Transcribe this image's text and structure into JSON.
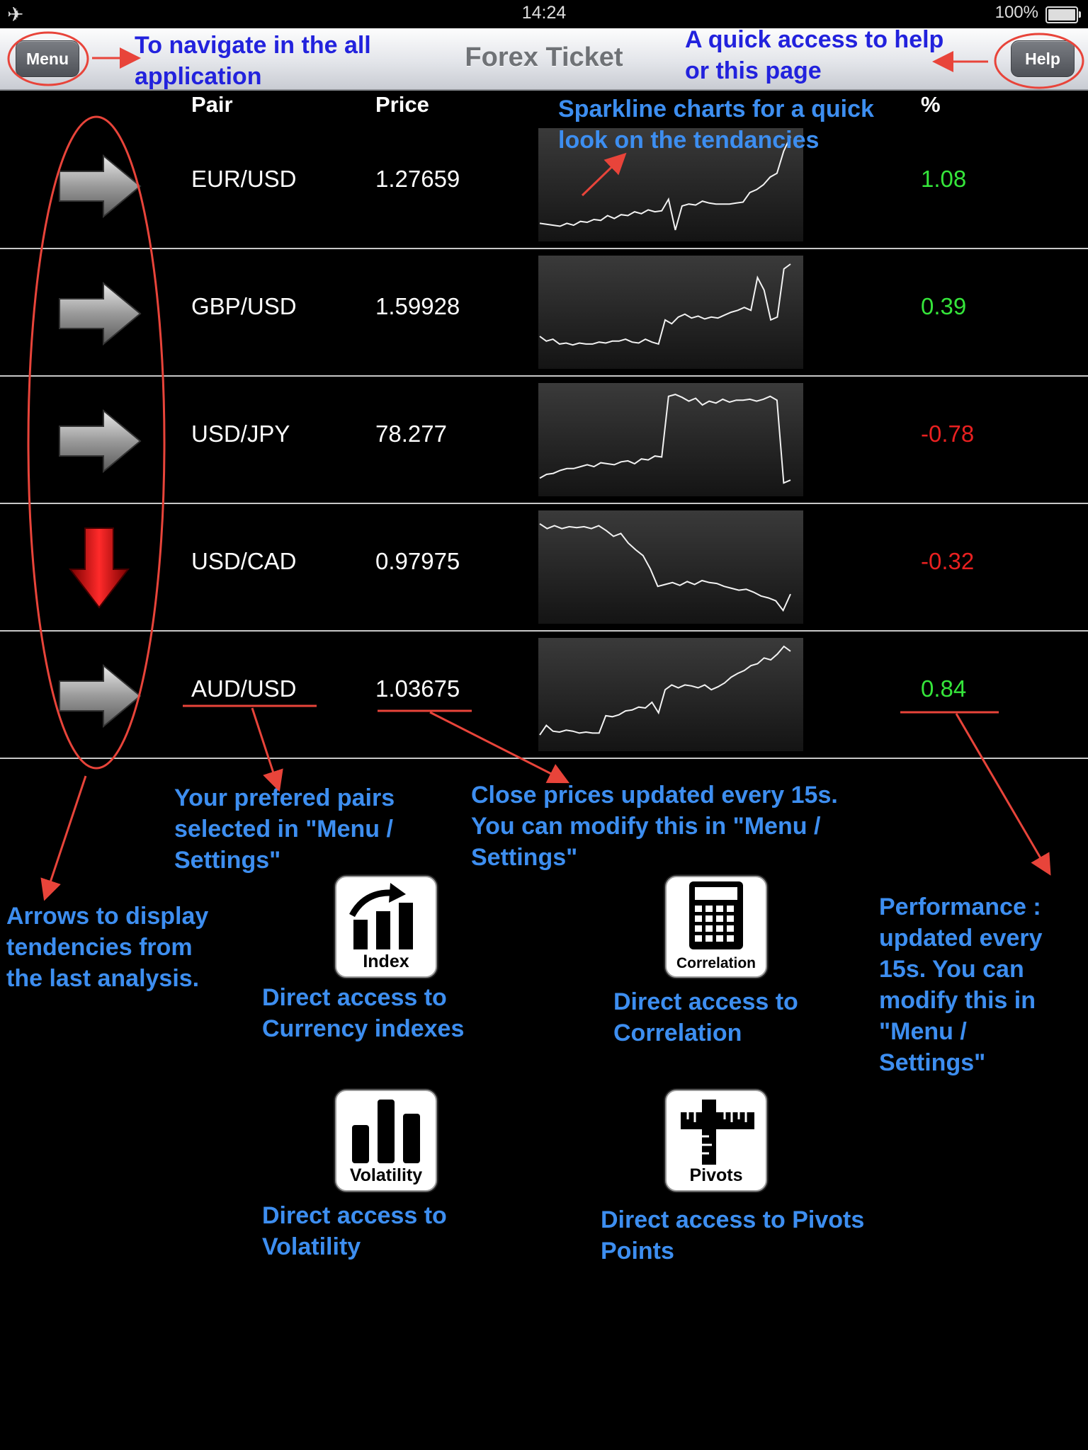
{
  "status": {
    "time": "14:24",
    "battery": "100%",
    "airplane_icon": "airplane-icon"
  },
  "nav": {
    "title": "Forex Ticket",
    "menu_label": "Menu",
    "help_label": "Help"
  },
  "table": {
    "headers": {
      "pair": "Pair",
      "price": "Price",
      "percent": "%"
    },
    "rows": [
      {
        "pair": "EUR/USD",
        "price": "1.27659",
        "pct": "1.08",
        "trend": "flat",
        "color": "#35e53a",
        "spark": [
          0.1,
          0.09,
          0.08,
          0.07,
          0.1,
          0.08,
          0.12,
          0.11,
          0.14,
          0.13,
          0.18,
          0.15,
          0.19,
          0.18,
          0.22,
          0.2,
          0.24,
          0.22,
          0.23,
          0.35,
          0.03,
          0.28,
          0.3,
          0.29,
          0.33,
          0.31,
          0.3,
          0.3,
          0.3,
          0.31,
          0.32,
          0.42,
          0.45,
          0.5,
          0.58,
          0.62,
          0.85,
          1.0
        ]
      },
      {
        "pair": "GBP/USD",
        "price": "1.59928",
        "pct": "0.39",
        "trend": "flat",
        "color": "#35e53a",
        "spark": [
          0.25,
          0.2,
          0.22,
          0.17,
          0.18,
          0.16,
          0.18,
          0.17,
          0.17,
          0.19,
          0.18,
          0.2,
          0.2,
          0.22,
          0.19,
          0.18,
          0.22,
          0.19,
          0.17,
          0.42,
          0.38,
          0.45,
          0.48,
          0.44,
          0.46,
          0.43,
          0.45,
          0.44,
          0.47,
          0.5,
          0.52,
          0.55,
          0.52,
          0.86,
          0.73,
          0.42,
          0.45,
          0.95,
          1.0
        ]
      },
      {
        "pair": "USD/JPY",
        "price": "78.277",
        "pct": "-0.78",
        "trend": "flat",
        "color": "#e82020",
        "spark": [
          0.1,
          0.14,
          0.15,
          0.18,
          0.2,
          0.2,
          0.22,
          0.24,
          0.22,
          0.26,
          0.25,
          0.24,
          0.27,
          0.28,
          0.25,
          0.3,
          0.29,
          0.33,
          0.32,
          0.95,
          0.97,
          0.94,
          0.9,
          0.93,
          0.86,
          0.9,
          0.88,
          0.92,
          0.89,
          0.91,
          0.91,
          0.92,
          0.9,
          0.92,
          0.95,
          0.91,
          0.05,
          0.08
        ]
      },
      {
        "pair": "USD/CAD",
        "price": "0.97975",
        "pct": "-0.32",
        "trend": "down",
        "color": "#e82020",
        "spark": [
          0.95,
          0.9,
          0.93,
          0.9,
          0.92,
          0.91,
          0.92,
          0.9,
          0.93,
          0.88,
          0.82,
          0.85,
          0.75,
          0.68,
          0.62,
          0.48,
          0.3,
          0.32,
          0.34,
          0.31,
          0.35,
          0.32,
          0.36,
          0.34,
          0.33,
          0.3,
          0.28,
          0.26,
          0.27,
          0.24,
          0.2,
          0.18,
          0.15,
          0.05,
          0.22
        ]
      },
      {
        "pair": "AUD/USD",
        "price": "1.03675",
        "pct": "0.84",
        "trend": "flat",
        "color": "#35e53a",
        "spark": [
          0.08,
          0.18,
          0.12,
          0.11,
          0.13,
          0.12,
          0.1,
          0.11,
          0.1,
          0.1,
          0.28,
          0.27,
          0.29,
          0.33,
          0.34,
          0.37,
          0.36,
          0.42,
          0.31,
          0.55,
          0.6,
          0.57,
          0.6,
          0.59,
          0.57,
          0.6,
          0.55,
          0.58,
          0.62,
          0.68,
          0.72,
          0.75,
          0.8,
          0.82,
          0.88,
          0.86,
          0.92,
          1.0,
          0.95
        ]
      }
    ]
  },
  "annotations": {
    "menu_note": [
      "To navigate in the all",
      "application"
    ],
    "help_note": [
      "A quick access to help",
      "or this page"
    ],
    "sparkline_note": [
      "Sparkline charts for a quick",
      "look on the tendancies"
    ],
    "pairs_note": [
      "Your prefered pairs",
      "selected in \"Menu /",
      "Settings\""
    ],
    "prices_note": [
      "Close prices updated every 15s.",
      "You can modify this in \"Menu /",
      "Settings\""
    ],
    "arrows_note": [
      "Arrows to display",
      "tendencies from",
      "the last analysis."
    ],
    "performance_note": [
      "Performance :",
      "updated every",
      "15s. You can",
      "modify this in",
      "\"Menu /",
      "Settings\""
    ],
    "index_note": [
      "Direct access to",
      "Currency indexes"
    ],
    "correlation_note": [
      "Direct access to",
      "Correlation"
    ],
    "volatility_note": [
      "Direct access to",
      "Volatility"
    ],
    "pivots_note": [
      "Direct access to Pivots",
      "Points"
    ]
  },
  "tiles": {
    "index": "Index",
    "correlation": "Correlation",
    "volatility": "Volatility",
    "pivots": "Pivots"
  }
}
